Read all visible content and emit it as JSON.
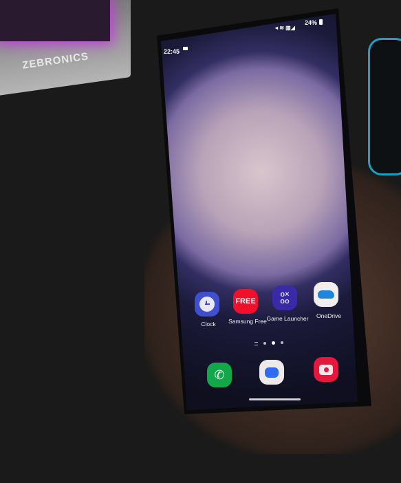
{
  "background": {
    "keyboard_brand": "ZEBRONICS"
  },
  "status_bar": {
    "time": "22:45",
    "battery": "24%"
  },
  "home": {
    "apps": [
      {
        "label": "Clock",
        "icon": "clock-icon",
        "color": "#3f4fcf"
      },
      {
        "label": "Samsung Free",
        "icon": "samsung-free-icon",
        "color": "#f0102b"
      },
      {
        "label": "Game Launcher",
        "icon": "game-launcher-icon",
        "color": "#3b2aa8"
      },
      {
        "label": "OneDrive",
        "icon": "onedrive-icon",
        "color": "#f2eeee"
      }
    ],
    "samsung_free_text": "FREE",
    "page_indicator": {
      "pages": 3,
      "current": 2
    },
    "dock": [
      {
        "icon": "phone-icon",
        "color": "#12a84a"
      },
      {
        "icon": "messages-icon",
        "color": "#eeeaea"
      },
      {
        "icon": "camera-icon",
        "color": "#e6163c"
      }
    ]
  }
}
